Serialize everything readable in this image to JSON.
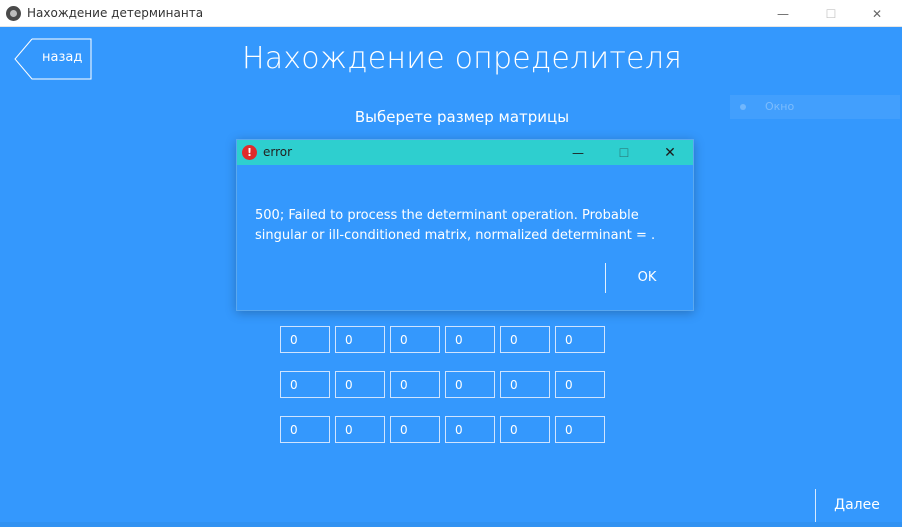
{
  "window": {
    "title": "Нахождение детерминанта",
    "minimize_glyph": "—",
    "maximize_glyph": "☐",
    "close_glyph": "✕"
  },
  "header": {
    "back_label": "назад",
    "page_title": "Нахождение определителя",
    "subtitle": "Выберете размер матрицы"
  },
  "ghost_window": {
    "label": "Окно"
  },
  "matrix": {
    "rows": [
      [
        "0",
        "0",
        "0",
        "0",
        "0",
        "0"
      ],
      [
        "0",
        "0",
        "0",
        "0",
        "0",
        "0"
      ],
      [
        "0",
        "0",
        "0",
        "0",
        "0",
        "0"
      ]
    ]
  },
  "footer": {
    "next_label": "Далее"
  },
  "dialog": {
    "title": "error",
    "icon": "error-icon",
    "message": "500; Failed to process the determinant operation. Probable singular or ill-conditioned matrix, normalized determinant = .",
    "ok_label": "OK",
    "minimize_glyph": "—",
    "maximize_glyph": "☐",
    "close_glyph": "✕"
  },
  "colors": {
    "background": "#3498fd",
    "dialog_titlebar": "#2ecfcf",
    "error_icon": "#e02b2b"
  }
}
